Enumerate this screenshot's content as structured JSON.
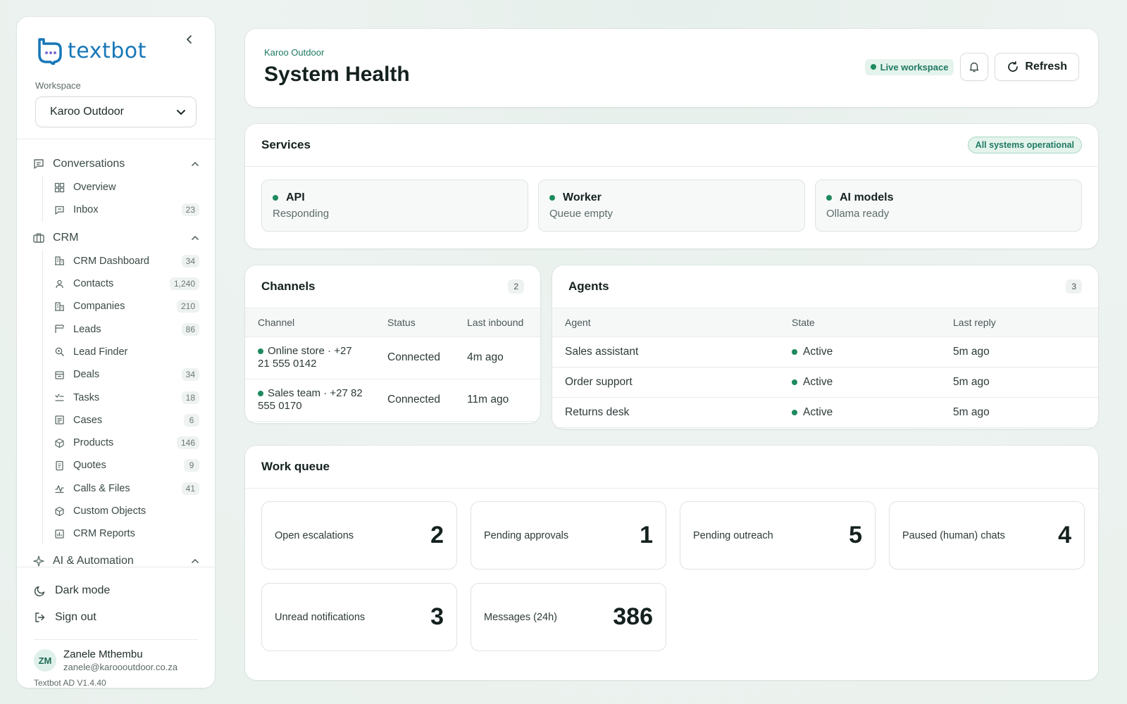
{
  "app": {
    "logo_text": "textbot",
    "workspace_label": "Workspace",
    "workspace_value": "Karoo Outdoor"
  },
  "colors": {
    "brand": "#1677b8",
    "accent": "#1f7a62",
    "status_ok": "#1d8a5e"
  },
  "sidebar": {
    "groups": [
      {
        "label": "Conversations",
        "icon": "chat-icon",
        "items": [
          {
            "label": "Overview",
            "icon": "grid-icon",
            "count": ""
          },
          {
            "label": "Inbox",
            "icon": "inbox-icon",
            "count": "23"
          }
        ]
      },
      {
        "label": "CRM",
        "icon": "briefcase-icon",
        "items": [
          {
            "label": "CRM Dashboard",
            "icon": "building-icon",
            "count": "34"
          },
          {
            "label": "Contacts",
            "icon": "contacts-icon",
            "count": "1,240"
          },
          {
            "label": "Companies",
            "icon": "building-icon",
            "count": "210"
          },
          {
            "label": "Leads",
            "icon": "funnel-icon",
            "count": "86"
          },
          {
            "label": "Lead Finder",
            "icon": "search-icon",
            "count": ""
          },
          {
            "label": "Deals",
            "icon": "deal-icon",
            "count": "34"
          },
          {
            "label": "Tasks",
            "icon": "tasks-icon",
            "count": "18"
          },
          {
            "label": "Cases",
            "icon": "cases-icon",
            "count": "6"
          },
          {
            "label": "Products",
            "icon": "box-icon",
            "count": "146"
          },
          {
            "label": "Quotes",
            "icon": "document-icon",
            "count": "9"
          },
          {
            "label": "Calls & Files",
            "icon": "activity-icon",
            "count": "41"
          },
          {
            "label": "Custom Objects",
            "icon": "box-icon",
            "count": ""
          },
          {
            "label": "CRM Reports",
            "icon": "chart-icon",
            "count": ""
          }
        ]
      },
      {
        "label": "AI & Automation",
        "icon": "sparkle-icon",
        "items": []
      }
    ],
    "dark_mode_label": "Dark mode",
    "sign_out_label": "Sign out",
    "user": {
      "initials": "ZM",
      "name": "Zanele Mthembu",
      "email": "zanele@karoooutdoor.co.za"
    },
    "version": "Textbot AD V1.4.40"
  },
  "header": {
    "breadcrumb": "Karoo Outdoor",
    "title": "System Health",
    "live_label": "Live workspace",
    "refresh_label": "Refresh"
  },
  "services": {
    "title": "Services",
    "status_pill": "All systems operational",
    "items": [
      {
        "name": "API",
        "status": "Responding"
      },
      {
        "name": "Worker",
        "status": "Queue empty"
      },
      {
        "name": "AI models",
        "status": "Ollama ready"
      }
    ]
  },
  "channels": {
    "title": "Channels",
    "count": "2",
    "columns": [
      "Channel",
      "Status",
      "Last inbound"
    ],
    "rows": [
      {
        "channel": "Online store · +27 21 555 0142",
        "status": "Connected",
        "last": "4m ago"
      },
      {
        "channel": "Sales team · +27 82 555 0170",
        "status": "Connected",
        "last": "11m ago"
      }
    ]
  },
  "agents": {
    "title": "Agents",
    "count": "3",
    "columns": [
      "Agent",
      "State",
      "Last reply"
    ],
    "rows": [
      {
        "agent": "Sales assistant",
        "state": "Active",
        "last": "5m ago"
      },
      {
        "agent": "Order support",
        "state": "Active",
        "last": "5m ago"
      },
      {
        "agent": "Returns desk",
        "state": "Active",
        "last": "5m ago"
      }
    ]
  },
  "work_queue": {
    "title": "Work queue",
    "tiles": [
      {
        "label": "Open escalations",
        "value": "2"
      },
      {
        "label": "Pending approvals",
        "value": "1"
      },
      {
        "label": "Pending outreach",
        "value": "5"
      },
      {
        "label": "Paused (human) chats",
        "value": "4"
      },
      {
        "label": "Unread notifications",
        "value": "3"
      },
      {
        "label": "Messages (24h)",
        "value": "386"
      }
    ]
  }
}
